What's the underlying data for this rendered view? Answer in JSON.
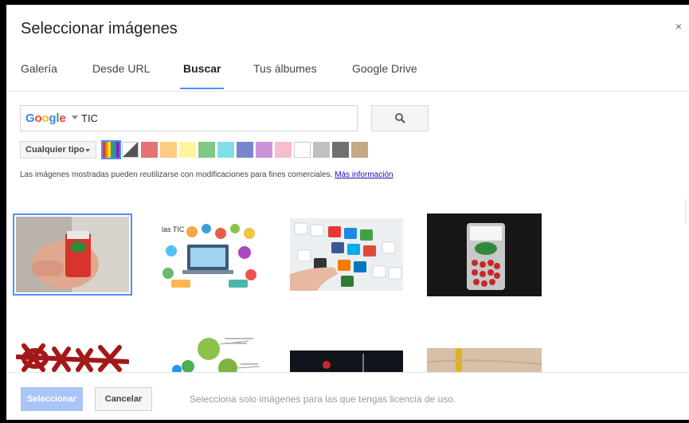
{
  "dialog": {
    "title": "Seleccionar imágenes",
    "close_label": "×"
  },
  "tabs": [
    {
      "label": "Galería",
      "active": false
    },
    {
      "label": "Desde URL",
      "active": false
    },
    {
      "label": "Buscar",
      "active": true
    },
    {
      "label": "Tus álbumes",
      "active": false
    },
    {
      "label": "Google Drive",
      "active": false
    }
  ],
  "search": {
    "provider": "Google",
    "value": "TIC",
    "button_icon": "search-icon"
  },
  "filters": {
    "type_label": "Cualquier tipo",
    "colors": [
      "multicolor",
      "black-white",
      "#e57373",
      "#ffcc80",
      "#fff59d",
      "#81c784",
      "#80deea",
      "#7986cb",
      "#ce93d8",
      "#f8bbd0",
      "#ffffff",
      "#c0c0c0",
      "#707070",
      "#c4a882"
    ],
    "selected_color_index": 0
  },
  "notice": {
    "text": "Las imágenes mostradas pueden reutilizarse con modificaciones para fines comerciales.",
    "link": "Más información"
  },
  "results": [
    {
      "name": "tic-tac-in-hand",
      "selected": true
    },
    {
      "name": "las-tic-illustration",
      "selected": false,
      "caption": "las TIC"
    },
    {
      "name": "keyboard-social-icons",
      "selected": false
    },
    {
      "name": "tic-tac-box-dark",
      "selected": false
    },
    {
      "name": "tic-tac-toe-red",
      "selected": false
    },
    {
      "name": "mind-map",
      "selected": false
    },
    {
      "name": "dark-photo",
      "selected": false
    },
    {
      "name": "skin-closeup",
      "selected": false
    }
  ],
  "footer": {
    "select_label": "Seleccionar",
    "cancel_label": "Cancelar",
    "note": "Selecciona solo imágenes para las que tengas licencia de uso."
  }
}
